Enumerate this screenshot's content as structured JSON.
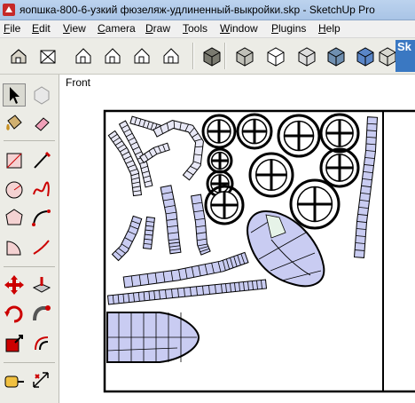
{
  "window": {
    "title": "яопшка-800-6-узкий фюзеляж-удлиненный-выкройки.skp - SketchUp Pro"
  },
  "menu": {
    "items": [
      {
        "u": "F",
        "rest": "ile"
      },
      {
        "u": "E",
        "rest": "dit"
      },
      {
        "u": "V",
        "rest": "iew"
      },
      {
        "u": "C",
        "rest": "amera"
      },
      {
        "u": "D",
        "rest": "raw"
      },
      {
        "u": "T",
        "rest": "ools"
      },
      {
        "u": "W",
        "rest": "indow"
      },
      {
        "u": "P",
        "rest": "lugins"
      },
      {
        "u": "H",
        "rest": "elp"
      }
    ]
  },
  "toolbar": {
    "views": [
      "iso-view-icon",
      "top-view-icon",
      "front-view-icon",
      "right-view-icon",
      "back-view-icon",
      "left-view-icon"
    ],
    "styles": [
      "xray-style-icon",
      "back-edges-style-icon",
      "wireframe-style-icon",
      "hidden-line-style-icon",
      "shaded-style-icon",
      "shaded-textures-style-icon",
      "monochrome-style-icon"
    ],
    "overflow_label": "Sk"
  },
  "left_tools": [
    [
      "select-tool-icon",
      "make-component-tool-icon"
    ],
    [
      "paint-bucket-tool-icon",
      "eraser-tool-icon"
    ],
    [
      "rectangle-tool-icon",
      "line-tool-icon"
    ],
    [
      "circle-tool-icon",
      "freehand-tool-icon"
    ],
    [
      "polygon-tool-icon",
      "arc-tool-icon"
    ],
    [
      "pie-tool-icon",
      "arc-2pt-tool-icon"
    ],
    [
      "move-tool-icon",
      "push-pull-tool-icon"
    ],
    [
      "rotate-tool-icon",
      "follow-me-tool-icon"
    ],
    [
      "scale-tool-icon",
      "offset-tool-icon"
    ],
    [
      "tape-measure-tool-icon",
      "dimension-tool-icon"
    ]
  ],
  "viewport": {
    "scene_label": "Front"
  },
  "colors": {
    "face_blue": "#c9ccf2",
    "face_dark": "#9aa0e2",
    "edge": "#000000",
    "title_bar": "#bcd3ee"
  }
}
